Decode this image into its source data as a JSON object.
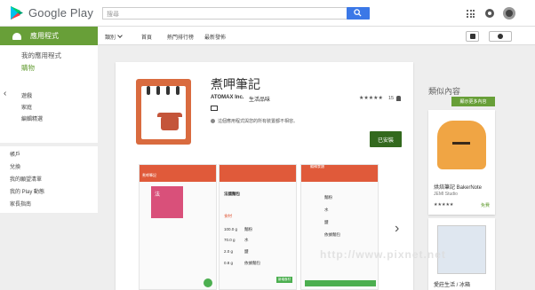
{
  "header": {
    "logo_text": "Google Play",
    "search_placeholder": "搜尋"
  },
  "nav": {
    "apps_tab": "應用程式",
    "category": "類別",
    "home": "首頁",
    "top_charts": "熱門排行榜",
    "new_releases": "最新發佈"
  },
  "sidebar": {
    "my_apps": "我的應用程式",
    "shop": "購物",
    "items": [
      "遊戲",
      "家庭",
      "編輯精選"
    ],
    "account": [
      "帳戶",
      "兌換",
      "我的願望清單",
      "我的 Play 動態",
      "家長指南"
    ]
  },
  "app": {
    "title": "煮呷筆記",
    "developer": "ATOMAX Inc.",
    "category": "生活品味",
    "stars": "★★★★★",
    "rating_count": "15",
    "warning": "這個應用程式與您的所有裝置都不相容。",
    "install_label": "已安裝"
  },
  "screenshots": [
    {
      "title": "煮呷筆記",
      "content": [
        "法"
      ]
    },
    {
      "title": "法國麵包",
      "content": [
        "食材",
        "100.0 g",
        "70.0 g",
        "2.0 g",
        "0.8 g",
        "麵粉",
        "水",
        "鹽",
        "依據麵包",
        "新增食材"
      ]
    },
    {
      "title": "編輯食譜",
      "content": [
        "麵粉",
        "水",
        "鹽",
        "依據麵包"
      ]
    }
  ],
  "similar": {
    "title": "類似內容",
    "more_label": "顯示更多內容",
    "items": [
      {
        "name": "烘焙筆記 BakerNote",
        "developer": "JEMI Studio",
        "stars": "★★★★★",
        "price": "免費"
      },
      {
        "name": "愛莊生活 / 冰箱"
      }
    ]
  },
  "watermark": "http://www.pixnet.net"
}
